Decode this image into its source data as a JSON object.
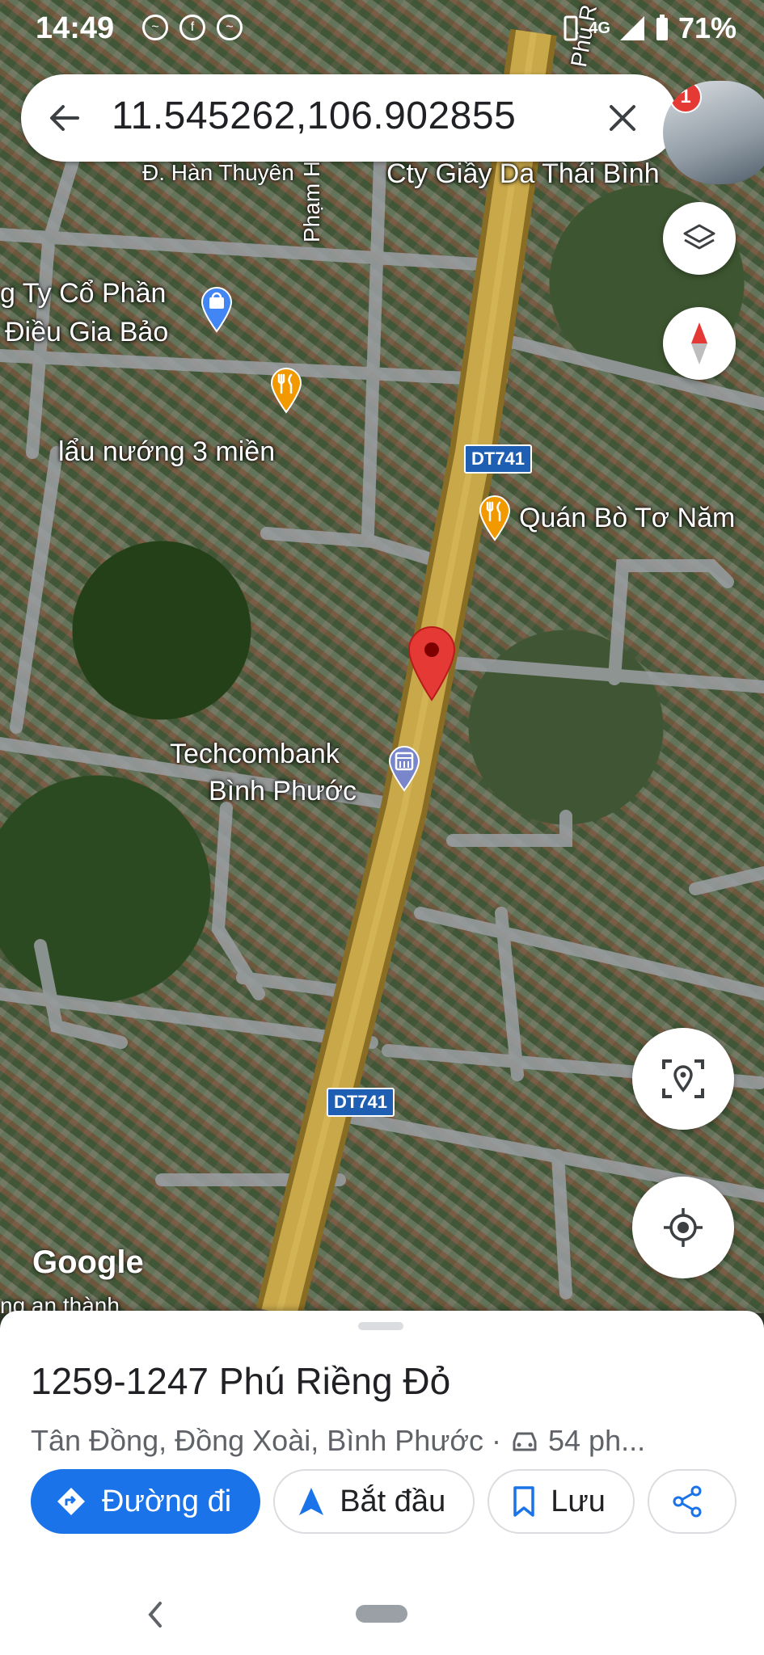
{
  "status_bar": {
    "time": "14:49",
    "battery": "71%",
    "network": "4G"
  },
  "search": {
    "query": "11.545262,106.902855"
  },
  "thumbnail": {
    "badge": "1"
  },
  "map_labels": {
    "han_thuyen": "Đ. Hàn Thuyên",
    "pham_hung": "Phạm Hùng",
    "cty_giay": "Cty Giầy Da Thái Bình",
    "gia_bao_1": "g Ty Cổ Phần",
    "gia_bao_2": "Điều Gia Bảo",
    "lau_nuong": "lẩu nướng 3 miền",
    "quan_bo": "Quán Bò Tơ Năm",
    "techcombank_1": "Techcombank",
    "techcombank_2": "Bình Phước",
    "road_dt741_a": "DT741",
    "road_dt741_b": "DT741",
    "road_phu_top": "Phú R",
    "bottom_partial": "ng an thành",
    "google": "Google"
  },
  "place": {
    "title": "1259-1247 Phú Riềng Đỏ",
    "address": "Tân Đồng, Đồng Xoài, Bình Phước ·",
    "drive_time": "54 ph..."
  },
  "actions": {
    "directions": "Đường đi",
    "start": "Bắt đầu",
    "save": "Lưu"
  },
  "colors": {
    "accent": "#1a73e8",
    "pin": "#e53935",
    "poi_food": "#f29900",
    "poi_shop": "#4285f4",
    "poi_bank": "#7986cb"
  }
}
